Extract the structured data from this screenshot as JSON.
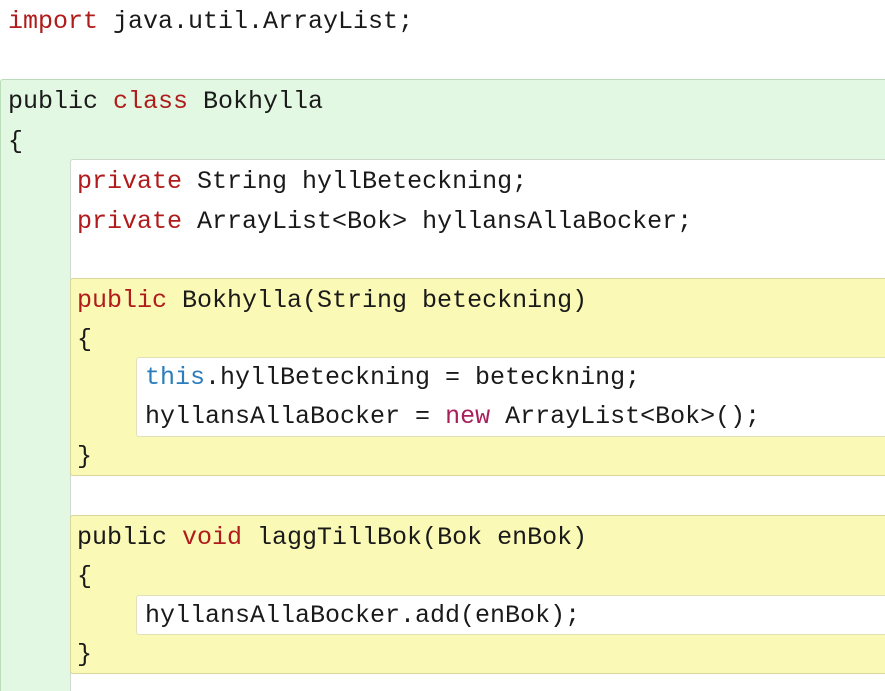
{
  "editor": {
    "import_line": {
      "kw": "import",
      "rest": " java.util.ArrayList;"
    },
    "class_header": {
      "kw1": "public",
      "kw2": " class",
      "name": " Bokhylla"
    },
    "class_open": "{",
    "field1": {
      "kw": "private",
      "rest": " String hyllBeteckning;"
    },
    "field2": {
      "kw": "private",
      "rest": " ArrayList<Bok> hyllansAllaBocker;"
    },
    "constructor": {
      "kw": "public",
      "sig": " Bokhylla(String beteckning)",
      "open": "{",
      "stmt1": {
        "kw": "this",
        "rest": ".hyllBeteckning = beteckning;"
      },
      "stmt2": {
        "pre": "hyllansAllaBocker = ",
        "kw": "new",
        "rest": " ArrayList<Bok>();"
      },
      "close": "}"
    },
    "method": {
      "kw1": "public",
      "kw2": " void",
      "sig": " laggTillBok(Bok enBok)",
      "open": "{",
      "stmt1": "hyllansAllaBocker.add(enBok);",
      "close": "}"
    }
  }
}
